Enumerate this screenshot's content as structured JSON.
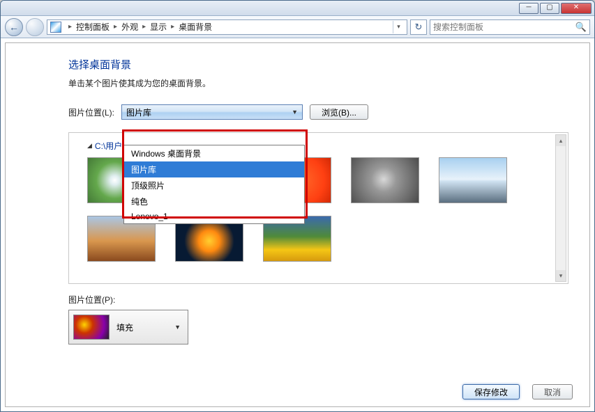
{
  "titlebar": {
    "min": "─",
    "max": "▢",
    "close": "✕"
  },
  "navbar": {
    "back_glyph": "←",
    "fwd_empty": "",
    "breadcrumbs": [
      "控制面板",
      "外观",
      "显示",
      "桌面背景"
    ],
    "sep": "▸",
    "refresh_glyph": "↻",
    "search_placeholder": "搜索控制面板"
  },
  "page": {
    "heading": "选择桌面背景",
    "subheading": "单击某个图片使其成为您的桌面背景。",
    "location_label": "图片位置(L):",
    "combo_value": "图片库",
    "browse_label": "浏览(B)...",
    "dropdown_items": [
      "Windows 桌面背景",
      "图片库",
      "顶级照片",
      "纯色",
      "Lenovo_1"
    ],
    "dropdown_selected_index": 1,
    "thumb_path": "C:\\用户\\",
    "position_label": "图片位置(P):",
    "fill_label": "填充",
    "save_label": "保存修改",
    "cancel_label": "取消"
  }
}
